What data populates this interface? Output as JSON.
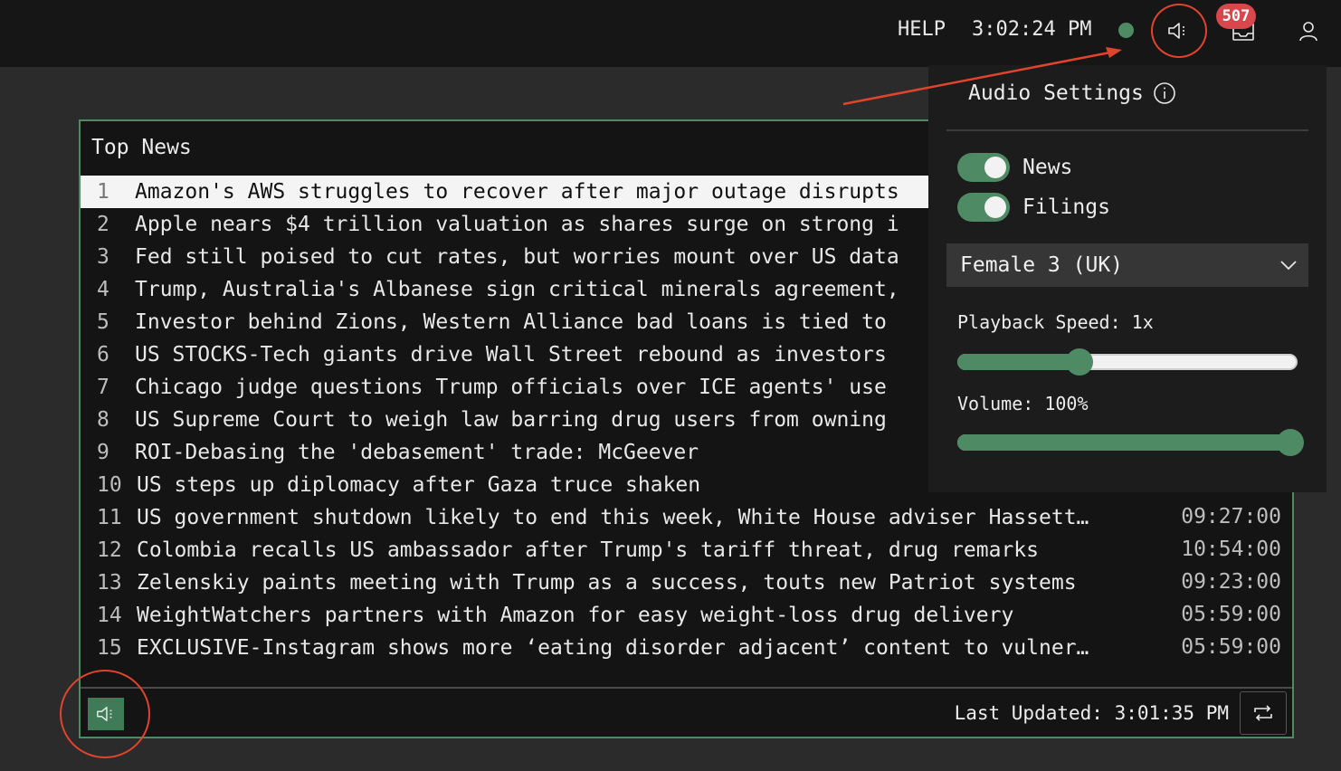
{
  "header": {
    "help_label": "HELP",
    "clock": "3:02:24 PM",
    "status_color": "#4e8a63",
    "notification_count": "507",
    "icons": [
      "speaker-icon",
      "inbox-icon",
      "user-icon"
    ]
  },
  "news_panel": {
    "title": "Top News",
    "items": [
      {
        "num": "1",
        "headline": "Amazon's AWS struggles to recover after major outage disrupts",
        "time": "",
        "selected": true
      },
      {
        "num": "2",
        "headline": "Apple nears $4 trillion valuation as shares surge on strong i",
        "time": ""
      },
      {
        "num": "3",
        "headline": "Fed still poised to cut rates, but worries mount over US data",
        "time": ""
      },
      {
        "num": "4",
        "headline": "Trump, Australia's Albanese sign critical minerals agreement,",
        "time": ""
      },
      {
        "num": "5",
        "headline": "Investor behind Zions, Western Alliance bad loans is tied to",
        "time": ""
      },
      {
        "num": "6",
        "headline": "US STOCKS-Tech giants drive Wall Street rebound as investors",
        "time": ""
      },
      {
        "num": "7",
        "headline": "Chicago judge questions Trump officials over ICE agents' use",
        "time": ""
      },
      {
        "num": "8",
        "headline": "US Supreme Court to weigh law barring drug users from owning",
        "time": ""
      },
      {
        "num": "9",
        "headline": "ROI-Debasing the 'debasement' trade: McGeever",
        "time": ""
      },
      {
        "num": "10",
        "headline": "US steps up diplomacy after Gaza truce shaken",
        "time": ""
      },
      {
        "num": "11",
        "headline": "US government shutdown likely to end this week, White House adviser Hassett…",
        "time": "09:27:00"
      },
      {
        "num": "12",
        "headline": "Colombia recalls US ambassador after Trump's tariff threat, drug remarks",
        "time": "10:54:00"
      },
      {
        "num": "13",
        "headline": "Zelenskiy paints meeting with Trump as a success, touts new Patriot systems",
        "time": "09:23:00"
      },
      {
        "num": "14",
        "headline": "WeightWatchers partners with Amazon for easy weight-loss drug delivery",
        "time": "05:59:00"
      },
      {
        "num": "15",
        "headline": "EXCLUSIVE-Instagram shows more ‘eating disorder adjacent’ content to vulner…",
        "time": "05:59:00"
      }
    ],
    "footer": {
      "last_updated": "Last Updated: 3:01:35 PM"
    }
  },
  "audio_settings": {
    "title": "Audio Settings",
    "toggles": [
      {
        "label": "News",
        "on": true
      },
      {
        "label": "Filings",
        "on": true
      }
    ],
    "voice": "Female 3 (UK)",
    "playback_speed_label": "Playback Speed: 1x",
    "playback_speed_level": 0.35,
    "volume_label": "Volume: 100%",
    "volume_level": 1.0
  },
  "colors": {
    "accent": "#4e8a63",
    "badge": "#d9464b",
    "annotation": "#e0442c"
  }
}
